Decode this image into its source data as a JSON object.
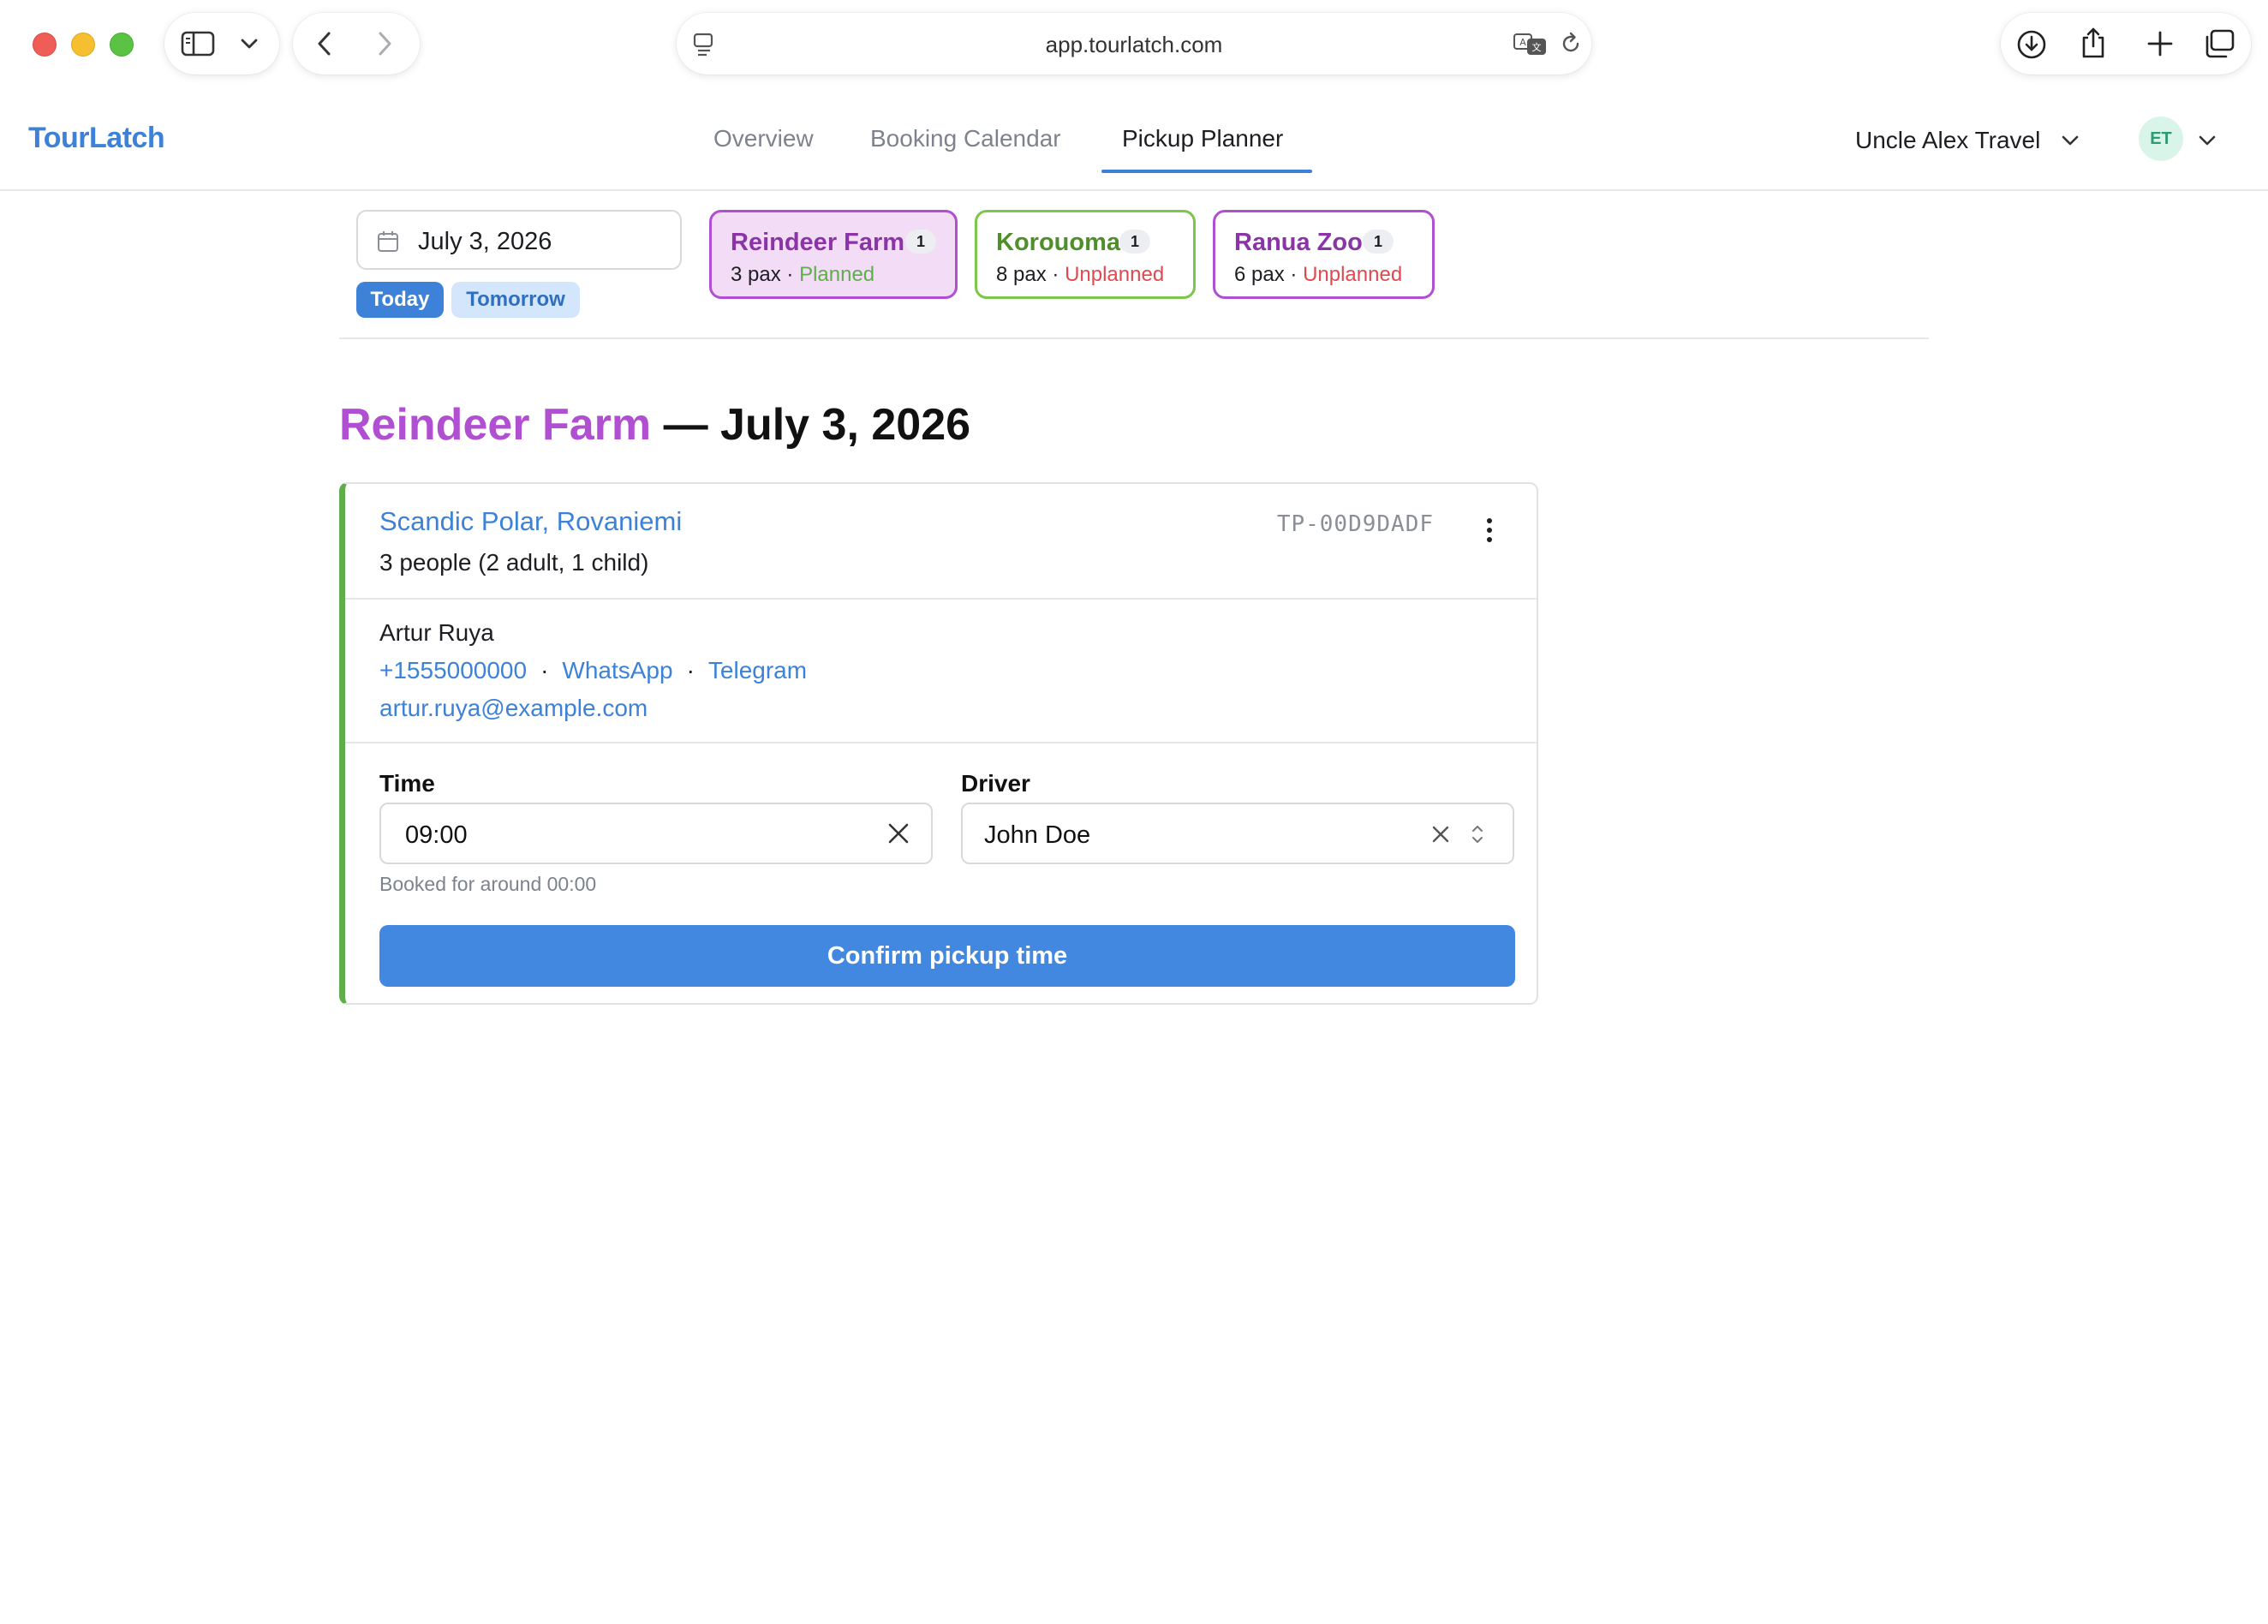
{
  "browser": {
    "url": "app.tourlatch.com"
  },
  "app": {
    "brand": "TourLatch",
    "nav": {
      "tabs": [
        {
          "label": "Overview",
          "active": false
        },
        {
          "label": "Booking Calendar",
          "active": false
        },
        {
          "label": "Pickup Planner",
          "active": true
        }
      ]
    },
    "agency": "Uncle Alex Travel",
    "avatar_initials": "ET"
  },
  "filters": {
    "date": "July 3, 2026",
    "quick": {
      "today": "Today",
      "tomorrow": "Tomorrow"
    },
    "destinations": [
      {
        "name": "Reindeer Farm",
        "count": "1",
        "pax": "3 pax",
        "sep": "·",
        "status": "Planned",
        "selected": true
      },
      {
        "name": "Korouoma",
        "count": "1",
        "pax": "8 pax",
        "sep": "·",
        "status": "Unplanned",
        "selected": false
      },
      {
        "name": "Ranua Zoo",
        "count": "1",
        "pax": "6 pax",
        "sep": "·",
        "status": "Unplanned",
        "selected": false
      }
    ]
  },
  "page": {
    "title_destination": "Reindeer Farm",
    "title_rest": " — July 3, 2026"
  },
  "booking": {
    "hotel": "Scandic Polar, Rovaniemi",
    "people": "3 people (2 adult, 1 child)",
    "code": "TP-00D9DADF",
    "contact": {
      "name": "Artur Ruya",
      "phone": "+1555000000",
      "whatsapp": "WhatsApp",
      "telegram": "Telegram",
      "dot": "·",
      "email": "artur.ruya@example.com"
    },
    "time": {
      "label": "Time",
      "value": "09:00",
      "hint": "Booked for around 00:00"
    },
    "driver": {
      "label": "Driver",
      "value": "John Doe"
    },
    "confirm_label": "Confirm pickup time"
  },
  "colors": {
    "accent": "#3d82d8",
    "reindeer": "#b04fd1",
    "korouoma": "#7cc64a",
    "planned": "#5fae4b",
    "unplanned": "#e0494f"
  }
}
